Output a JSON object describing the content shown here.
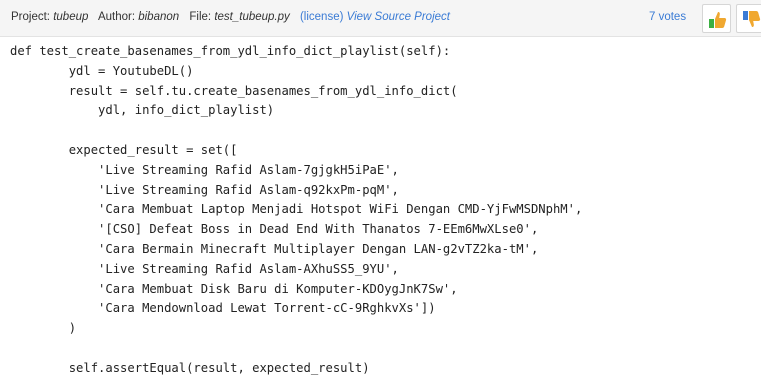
{
  "header": {
    "project_label": "Project:",
    "project_value": "tubeup",
    "author_label": "Author:",
    "author_value": "bibanon",
    "file_label": "File:",
    "file_value": "test_tubeup.py",
    "license_text": "(license)",
    "view_source_text": "View Source Project",
    "votes_text": "7 votes",
    "thumb_up_icon": "thumbs-up-icon",
    "thumb_down_icon": "thumbs-down-icon",
    "accent_color": "#3a7bd5",
    "thumb_color": "#f0a830",
    "thumb_up_base_color": "#3cb043"
  },
  "code": {
    "lines": [
      "def test_create_basenames_from_ydl_info_dict_playlist(self):",
      "        ydl = YoutubeDL()",
      "        result = self.tu.create_basenames_from_ydl_info_dict(",
      "            ydl, info_dict_playlist)",
      "",
      "        expected_result = set([",
      "            'Live Streaming Rafid Aslam-7gjgkH5iPaE',",
      "            'Live Streaming Rafid Aslam-q92kxPm-pqM',",
      "            'Cara Membuat Laptop Menjadi Hotspot WiFi Dengan CMD-YjFwMSDNphM',",
      "            '[CSO] Defeat Boss in Dead End With Thanatos 7-EEm6MwXLse0',",
      "            'Cara Bermain Minecraft Multiplayer Dengan LAN-g2vTZ2ka-tM',",
      "            'Live Streaming Rafid Aslam-AXhuSS5_9YU',",
      "            'Cara Membuat Disk Baru di Komputer-KDOygJnK7Sw',",
      "            'Cara Mendownload Lewat Torrent-cC-9RghkvXs'])",
      "        )",
      "",
      "        self.assertEqual(result, expected_result)"
    ]
  }
}
